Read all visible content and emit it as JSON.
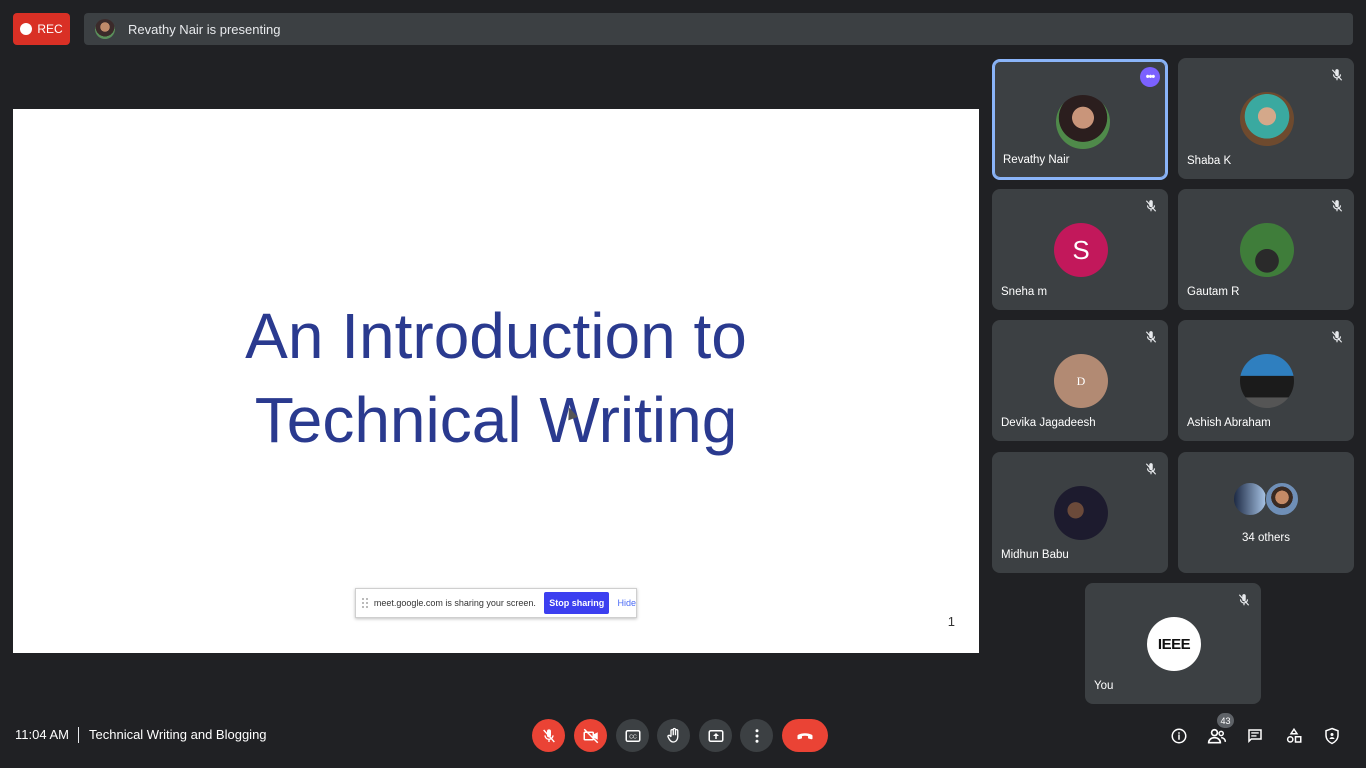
{
  "top": {
    "rec_label": "REC",
    "presenting_text": "Revathy Nair is presenting"
  },
  "slide": {
    "title_line1": "An Introduction to",
    "title_line2": "Technical Writing",
    "page_number": "1",
    "share_notice": {
      "text": "meet.google.com is sharing your screen.",
      "stop_label": "Stop sharing",
      "hide_label": "Hide"
    }
  },
  "participants": [
    {
      "name": "Revathy Nair",
      "avatar": "photo-woman-dark-hair",
      "muted": false,
      "active": true
    },
    {
      "name": "Shaba K",
      "avatar": "photo-woman-headscarf",
      "muted": true
    },
    {
      "name": "Sneha m",
      "avatar_letter": "S",
      "avatar_color": "#c2185b",
      "muted": true
    },
    {
      "name": "Gautam R",
      "avatar": "photo-motorbike-green",
      "muted": true
    },
    {
      "name": "Devika Jagadeesh",
      "avatar_letter": "D",
      "avatar_color": "#b28a73",
      "muted": true
    },
    {
      "name": "Ashish Abraham",
      "avatar": "photo-car",
      "muted": true
    },
    {
      "name": "Midhun Babu",
      "avatar": "photo-dark-figure",
      "muted": true
    },
    {
      "others_label": "34 others"
    },
    {
      "name": "You",
      "avatar": "ieee-logo",
      "logo_text": "IEEE",
      "muted": true
    }
  ],
  "bottom": {
    "time": "11:04 AM",
    "meeting_title": "Technical Writing and Blogging",
    "people_count": "43",
    "controls": [
      "mic-off-icon",
      "camera-off-icon",
      "captions-icon",
      "raise-hand-icon",
      "present-icon",
      "more-options-icon",
      "end-call-icon"
    ],
    "right_icons": [
      "info-icon",
      "people-icon",
      "chat-icon",
      "activities-icon",
      "host-controls-icon"
    ]
  },
  "colors": {
    "background": "#202124",
    "tile": "#3c4043",
    "danger": "#ea4335",
    "active_border": "#8ab4f8",
    "slide_title": "#2a3a8f"
  }
}
